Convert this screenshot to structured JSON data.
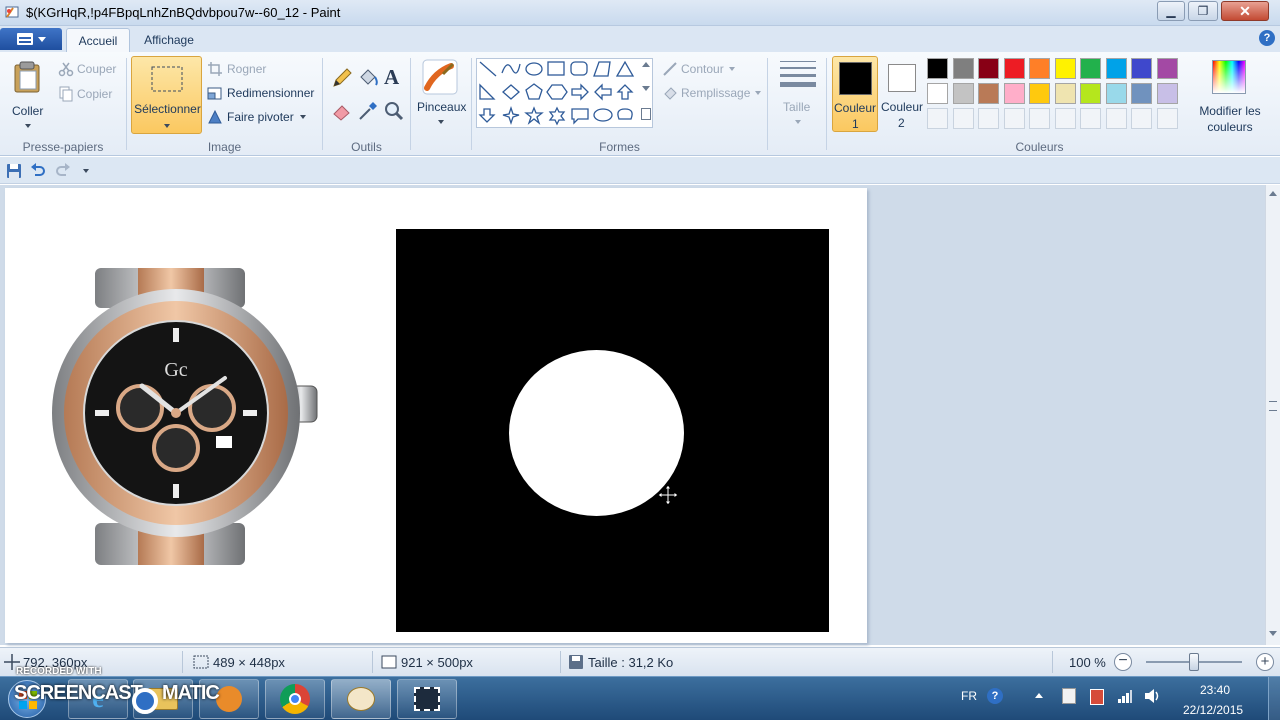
{
  "window": {
    "title": "$(KGrHqR,!p4FBpqLnhZnBQdvbpou7w--60_12 - Paint",
    "min_label": "▁",
    "max_label": "❐",
    "close_label": "✕"
  },
  "tabs": [
    "Accueil",
    "Affichage"
  ],
  "help_label": "?",
  "ribbon": {
    "clipboard": {
      "label": "Presse-papiers",
      "paste": "Coller",
      "cut": "Couper",
      "copy": "Copier"
    },
    "image": {
      "label": "Image",
      "select": "Sélectionner",
      "crop": "Rogner",
      "resize": "Redimensionner",
      "rotate": "Faire pivoter"
    },
    "tools": {
      "label": "Outils"
    },
    "brushes": {
      "label": "Pinceaux"
    },
    "shapes": {
      "label": "Formes",
      "outline": "Contour",
      "fill": "Remplissage"
    },
    "size": {
      "label": "Taille"
    },
    "colors": {
      "label": "Couleurs",
      "color1_line1": "Couleur",
      "color1_line2": "1",
      "color2_line1": "Couleur",
      "color2_line2": "2",
      "edit_line1": "Modifier les",
      "edit_line2": "couleurs",
      "color1": "#000000",
      "color2": "#ffffff",
      "palette_row1": [
        "#000000",
        "#7f7f7f",
        "#880015",
        "#ed1c24",
        "#ff7f27",
        "#fff200",
        "#22b14c",
        "#00a2e8",
        "#3f48cc",
        "#a349a4"
      ],
      "palette_row2": [
        "#ffffff",
        "#c3c3c3",
        "#b97a57",
        "#ffaec9",
        "#ffc90e",
        "#efe4b0",
        "#b5e61d",
        "#99d9ea",
        "#7092be",
        "#c8bfe7"
      ]
    }
  },
  "status": {
    "cursor_pos": "792, 360px",
    "selection_size": "489 × 448px",
    "image_size": "921 × 500px",
    "file_size": "Taille : 31,2 Ko",
    "zoom": "100 %",
    "zoom_fraction": 0.5
  },
  "taskbar": {
    "watermark_line1": "RECORDED WITH",
    "watermark_line2": "SCREENCAST",
    "watermark_line3": "MATIC",
    "lang": "FR",
    "time": "23:40",
    "date": "22/12/2015"
  }
}
